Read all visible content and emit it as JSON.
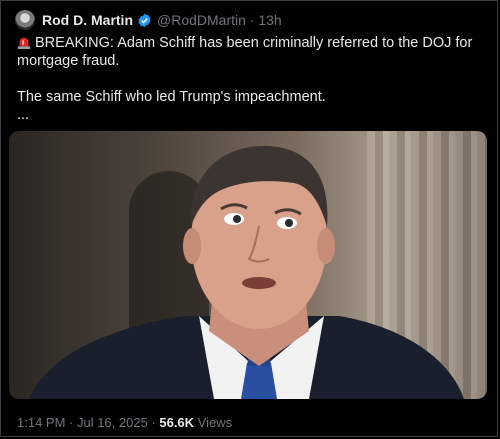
{
  "tweet": {
    "author_name": "Rod D. Martin",
    "handle_time": "@RodDMartin · 13h",
    "line1": "BREAKING: Adam Schiff has been criminally referred to the DOJ for mortgage fraud.",
    "line2": "The same Schiff who led Trump's impeachment.",
    "ellipsis": "...",
    "timestamp": "1:14 PM · Jul 16, 2025 · ",
    "views_count": "56.6K",
    "views_label": " Views"
  },
  "icons": {
    "avatar": "avatar",
    "verified": "verified-badge-icon",
    "siren": "siren-emoji-icon"
  },
  "colors": {
    "background": "#000000",
    "text": "#e7e9ea",
    "secondary": "#71767b",
    "verified": "#1d9bf0",
    "siren": "#d92b2b"
  }
}
